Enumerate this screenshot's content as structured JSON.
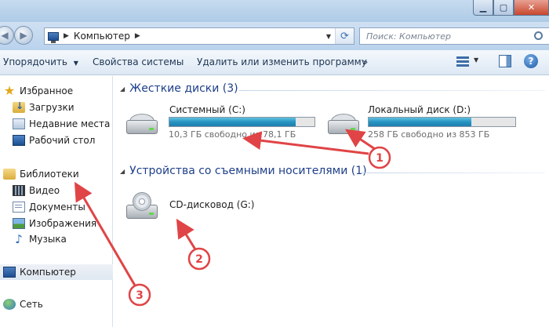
{
  "address_bar": {
    "path": [
      "Компьютер"
    ],
    "search_placeholder": "Поиск: Компьютер"
  },
  "toolbar": {
    "organize_label": "Упорядочить",
    "properties_label": "Свойства системы",
    "uninstall_label": "Удалить или изменить программу",
    "more_label": "»"
  },
  "sidebar": {
    "favorites": {
      "label": "Избранное",
      "items": [
        {
          "label": "Загрузки",
          "icon": "downloads-folder-icon"
        },
        {
          "label": "Недавние места",
          "icon": "recent-places-icon"
        },
        {
          "label": "Рабочий стол",
          "icon": "desktop-icon"
        }
      ]
    },
    "libraries": {
      "label": "Библиотеки",
      "items": [
        {
          "label": "Видео",
          "icon": "video-icon"
        },
        {
          "label": "Документы",
          "icon": "documents-icon"
        },
        {
          "label": "Изображения",
          "icon": "pictures-icon"
        },
        {
          "label": "Музыка",
          "icon": "music-icon"
        }
      ]
    },
    "computer": {
      "label": "Компьютер",
      "selected": true
    },
    "network": {
      "label": "Сеть"
    }
  },
  "content": {
    "hard_drives": {
      "header": "Жесткие диски (3)",
      "drives": [
        {
          "name": "Системный (C:)",
          "free_text": "10,3 ГБ свободно из 78,1 ГБ",
          "used_fraction": 0.87
        },
        {
          "name": "Локальный диск (D:)",
          "free_text": "258 ГБ свободно из 853 ГБ",
          "used_fraction": 0.7
        }
      ]
    },
    "removable": {
      "header": "Устройства со съемными носителями (1)",
      "devices": [
        {
          "name": "CD-дисковод (G:)"
        }
      ]
    }
  },
  "annotations": {
    "color": "#e04446",
    "badges": [
      "1",
      "2",
      "3"
    ]
  },
  "colors": {
    "group_header": "#1e3f8a",
    "drive_bar_fill": "#2793c2",
    "close_button": "#c8462d"
  }
}
